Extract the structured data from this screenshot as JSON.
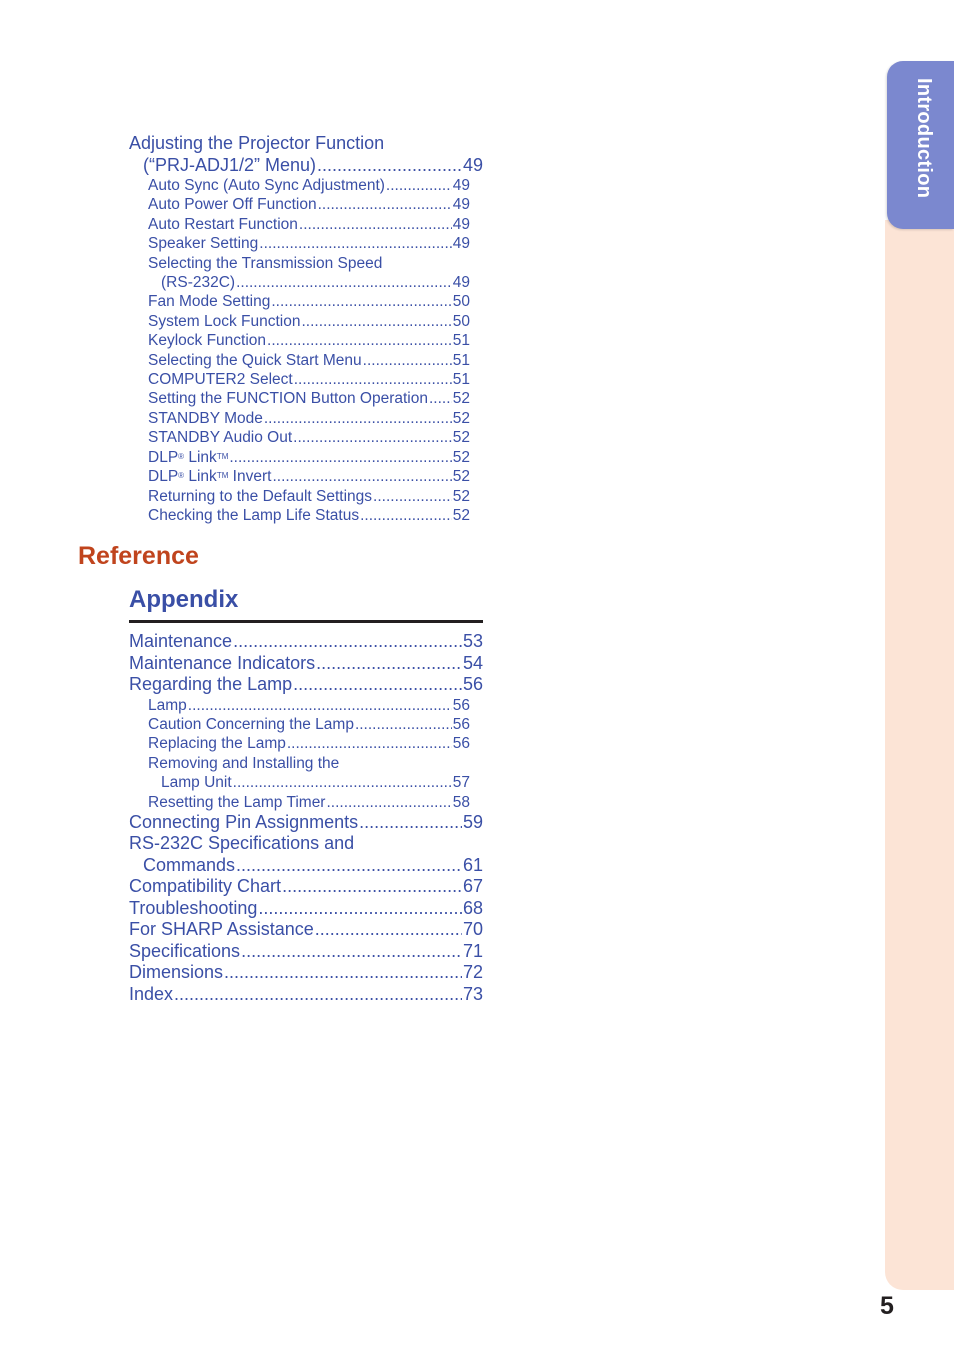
{
  "side_tab": {
    "label": "Introduction"
  },
  "page_number": "5",
  "section1": {
    "header_line1": "Adjusting the Projector Function",
    "header_line2": "(“PRJ-ADJ1/2” Menu)",
    "header_page": "49",
    "items": [
      {
        "label": "Auto Sync (Auto Sync Adjustment)",
        "page": "49"
      },
      {
        "label": "Auto Power Off Function",
        "page": "49"
      },
      {
        "label": "Auto Restart Function",
        "page": "49"
      },
      {
        "label": "Speaker Setting",
        "page": "49"
      },
      {
        "label": "Selecting the Transmission Speed",
        "cont": "(RS-232C)",
        "page": "49"
      },
      {
        "label": "Fan Mode Setting",
        "page": "50"
      },
      {
        "label": "System Lock Function",
        "page": "50"
      },
      {
        "label": "Keylock Function",
        "page": "51"
      },
      {
        "label": "Selecting the Quick Start Menu",
        "page": "51"
      },
      {
        "label": "COMPUTER2 Select",
        "page": "51"
      },
      {
        "label": "Setting the FUNCTION Button Operation",
        "page": "52"
      },
      {
        "label": "STANDBY Mode",
        "page": "52"
      },
      {
        "label": "STANDBY Audio Out",
        "page": "52"
      },
      {
        "label_a": "DLP",
        "sup_a": "®",
        "label_b": " Link",
        "sup_b": "TM",
        "label_c": "",
        "page": "52"
      },
      {
        "label_a": "DLP",
        "sup_a": "®",
        "label_b": " Link",
        "sup_b": "TM",
        "label_c": " Invert",
        "page": "52"
      },
      {
        "label": "Returning to the Default Settings",
        "page": "52"
      },
      {
        "label": "Checking the Lamp Life Status",
        "page": "52"
      }
    ]
  },
  "reference": {
    "title": "Reference"
  },
  "appendix": {
    "title": "Appendix",
    "entries": [
      {
        "label": "Maintenance",
        "page": "53"
      },
      {
        "label": "Maintenance Indicators",
        "page": "54"
      },
      {
        "label": "Regarding the Lamp",
        "page": "56"
      }
    ],
    "lamp_items": [
      {
        "label": "Lamp",
        "page": "56"
      },
      {
        "label": "Caution Concerning the Lamp",
        "page": "56"
      },
      {
        "label": "Replacing the Lamp",
        "page": "56"
      },
      {
        "label": "Removing and Installing the",
        "cont": "Lamp Unit",
        "page": "57"
      },
      {
        "label": "Resetting the Lamp Timer",
        "page": "58"
      }
    ],
    "entries2": [
      {
        "label": "Connecting Pin Assignments",
        "page": "59"
      },
      {
        "label": "RS-232C Specifications and",
        "cont": "Commands",
        "page": "61"
      },
      {
        "label": "Compatibility Chart",
        "page": "67"
      },
      {
        "label": "Troubleshooting",
        "page": "68"
      },
      {
        "label": "For SHARP Assistance",
        "page": "70"
      },
      {
        "label": "Specifications",
        "page": "71"
      },
      {
        "label": "Dimensions",
        "page": "72"
      },
      {
        "label": "Index",
        "page": "73"
      }
    ]
  }
}
